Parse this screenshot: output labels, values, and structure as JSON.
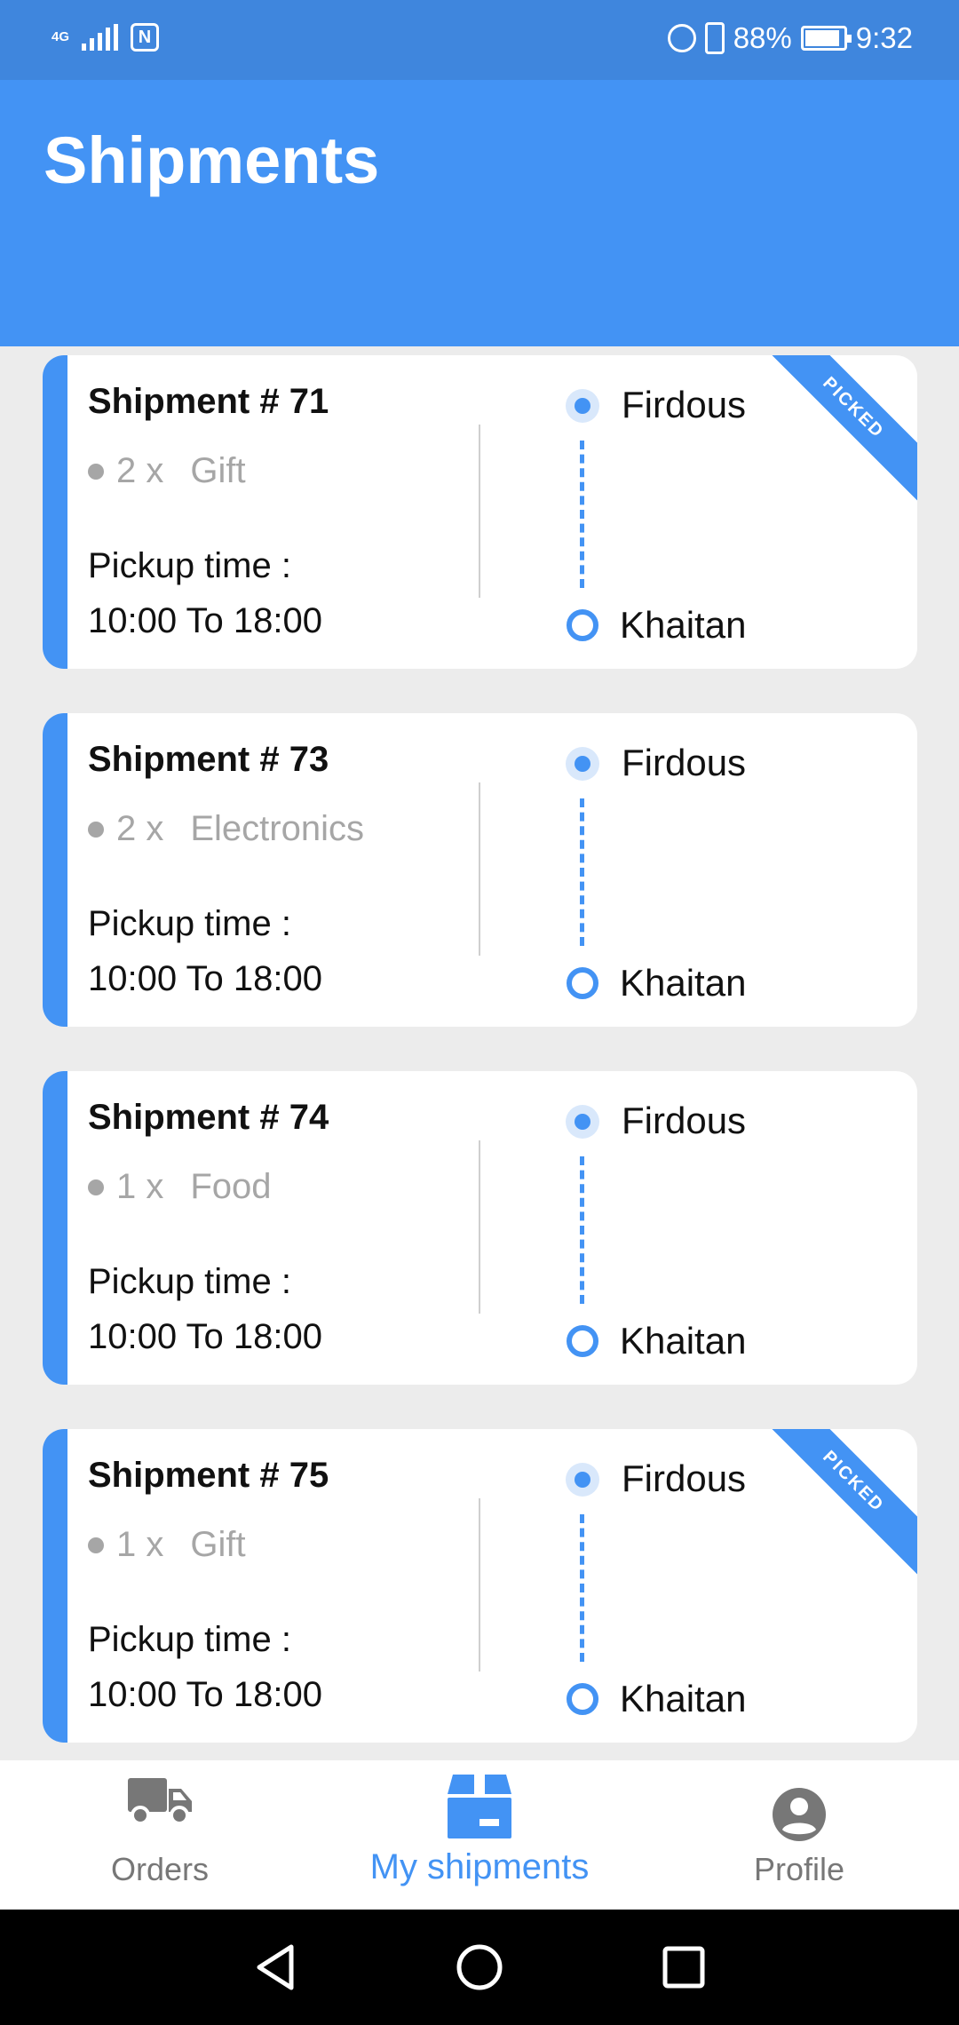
{
  "status_bar": {
    "network": "4G",
    "nfc": "N",
    "battery_percent": "88%",
    "time": "9:32"
  },
  "header": {
    "title": "Shipments"
  },
  "shipments": [
    {
      "title": "Shipment # 71",
      "quantity": "2 x",
      "category": "Gift",
      "pickup_label": "Pickup time :",
      "pickup_time": "10:00 To 18:00",
      "from": "Firdous",
      "to": "Khaitan",
      "ribbon": "PICKED"
    },
    {
      "title": "Shipment # 73",
      "quantity": "2 x",
      "category": "Electronics",
      "pickup_label": "Pickup time :",
      "pickup_time": "10:00 To 18:00",
      "from": "Firdous",
      "to": "Khaitan",
      "ribbon": ""
    },
    {
      "title": "Shipment # 74",
      "quantity": "1 x",
      "category": "Food",
      "pickup_label": "Pickup time :",
      "pickup_time": "10:00 To 18:00",
      "from": "Firdous",
      "to": "Khaitan",
      "ribbon": ""
    },
    {
      "title": "Shipment # 75",
      "quantity": "1 x",
      "category": "Gift",
      "pickup_label": "Pickup time :",
      "pickup_time": "10:00 To 18:00",
      "from": "Firdous",
      "to": "Khaitan",
      "ribbon": "PICKED"
    }
  ],
  "bottom_nav": {
    "items": [
      {
        "label": "Orders",
        "icon": "truck-icon",
        "active": false
      },
      {
        "label": "My shipments",
        "icon": "box-icon",
        "active": true
      },
      {
        "label": "Profile",
        "icon": "account-icon",
        "active": false
      }
    ]
  },
  "colors": {
    "primary": "#4393f4",
    "status_bar": "#3f86dd",
    "inactive": "#777777",
    "muted_text": "#a6a6a6"
  }
}
